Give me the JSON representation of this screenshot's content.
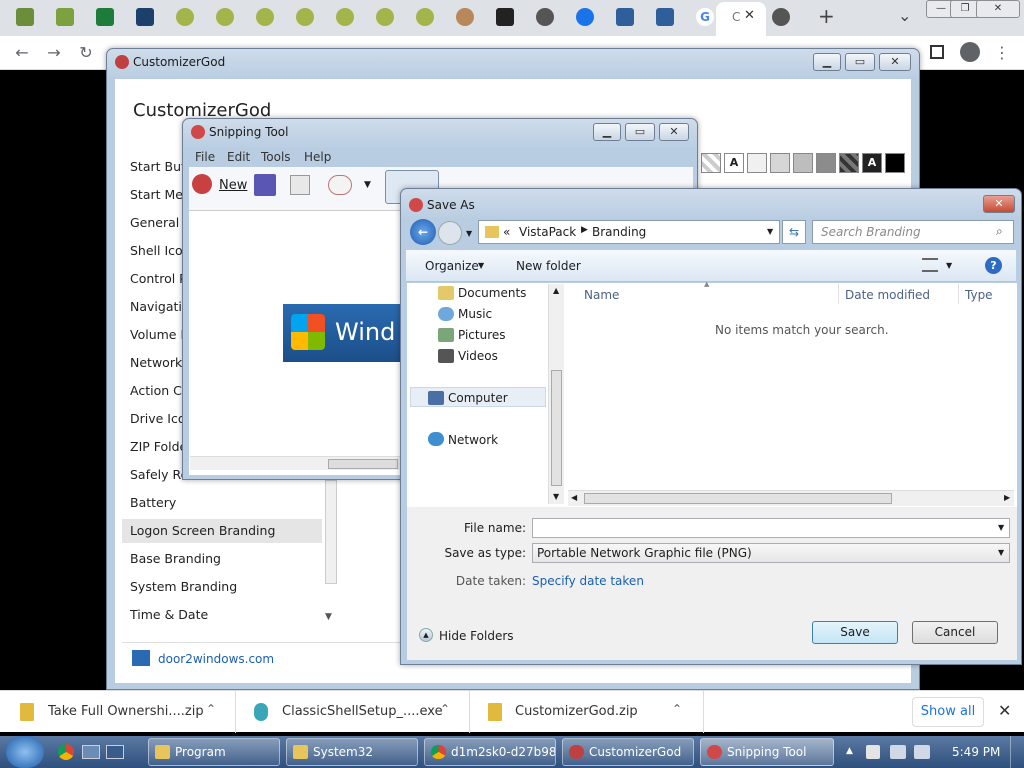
{
  "browser": {
    "active_tab_label": "C",
    "new_tab_symbol": "+",
    "tab_search_symbol": "⌄",
    "win_min": "—",
    "win_max": "❐",
    "win_close": "✕",
    "back": "←",
    "forward": "→",
    "reload": "↻",
    "menu": "⋮"
  },
  "customizergod": {
    "window_title": "CustomizerGod",
    "heading": "CustomizerGod",
    "items": [
      "Start Butt",
      "Start Men",
      "General Ic",
      "Shell Icon",
      "Control P",
      "Navigatio",
      "Volume Ic",
      "Network I",
      "Action Ce",
      "Drive Icon",
      "ZIP Folde",
      "Safely Re",
      "Battery",
      "Logon Screen Branding",
      "Base Branding",
      "System Branding",
      "Time & Date"
    ],
    "selected_item": "Logon Screen Branding",
    "footer_link": "door2windows.com",
    "swatch_letter": "A"
  },
  "snipping": {
    "window_title": "Snipping Tool",
    "menu": [
      "File",
      "Edit",
      "Tools",
      "Help"
    ],
    "new_label": "New",
    "preview_text": "Wind"
  },
  "saveas": {
    "window_title": "Save As",
    "breadcrumb_prefix": "«",
    "breadcrumb": [
      "VistaPack",
      "Branding"
    ],
    "search_placeholder": "Search Branding",
    "organize": "Organize",
    "new_folder": "New folder",
    "nav": {
      "libraries": [
        "Documents",
        "Music",
        "Pictures",
        "Videos"
      ],
      "computer": "Computer",
      "network": "Network"
    },
    "columns": [
      "Name",
      "Date modified",
      "Type"
    ],
    "empty_message": "No items match your search.",
    "file_name_label": "File name:",
    "file_name_value": "",
    "save_as_type_label": "Save as type:",
    "save_as_type_value": "Portable Network Graphic file (PNG)",
    "date_taken_label": "Date taken:",
    "date_taken_link": "Specify date taken",
    "hide_folders": "Hide Folders",
    "save": "Save",
    "cancel": "Cancel",
    "help_symbol": "?"
  },
  "downloads": {
    "items": [
      "Take Full Ownershi....zip",
      "ClassicShellSetup_....exe",
      "CustomizerGod.zip"
    ],
    "show_all": "Show all",
    "close": "✕"
  },
  "taskbar": {
    "tasks": [
      "Program",
      "System32",
      "d1m2sk0-d27b98...",
      "CustomizerGod",
      "Snipping Tool"
    ],
    "clock": "5:49 PM"
  },
  "colors": {
    "accent_link": "#1a5fb4",
    "taskbar": "#2f4f7d",
    "selection": "#e5e5e5"
  }
}
